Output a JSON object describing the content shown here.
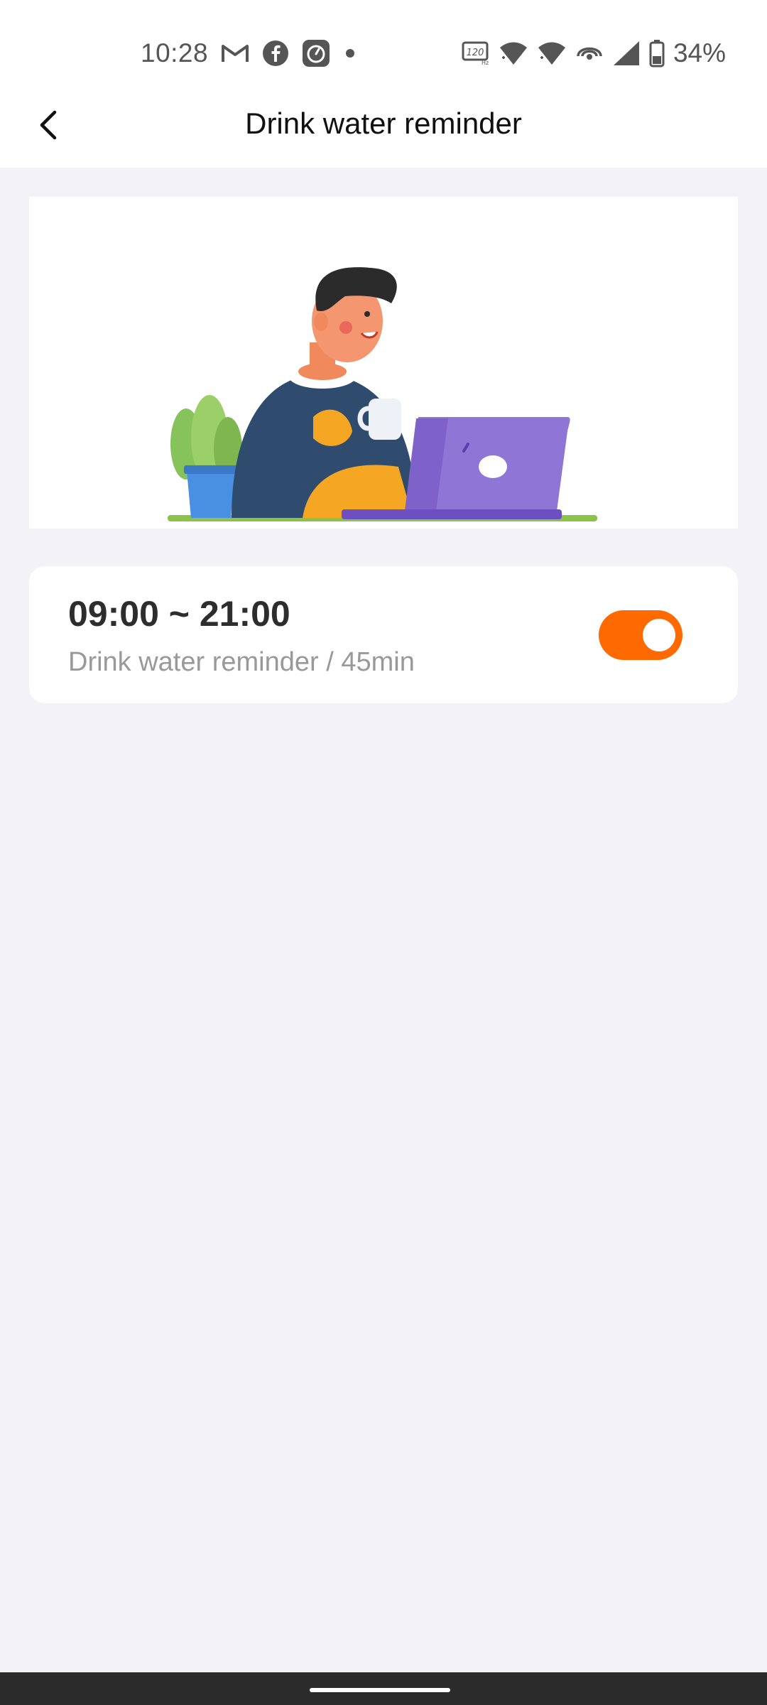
{
  "status_bar": {
    "time": "10:28",
    "battery": "34%",
    "left_icons": [
      "gmail-icon",
      "facebook-icon",
      "timer-app-icon",
      "dot-icon"
    ],
    "right_icons": [
      "120hz-icon",
      "wifi-icon",
      "wifi-icon",
      "hotspot-icon",
      "signal-icon",
      "battery-icon"
    ]
  },
  "app_bar": {
    "title": "Drink water reminder",
    "back_icon": "chevron-left-icon"
  },
  "reminder": {
    "time_range": "09:00 ~ 21:00",
    "description": "Drink water reminder / 45min",
    "enabled": true
  },
  "colors": {
    "accent": "#ff6a00",
    "background": "#f2f2f7",
    "card": "#ffffff"
  }
}
